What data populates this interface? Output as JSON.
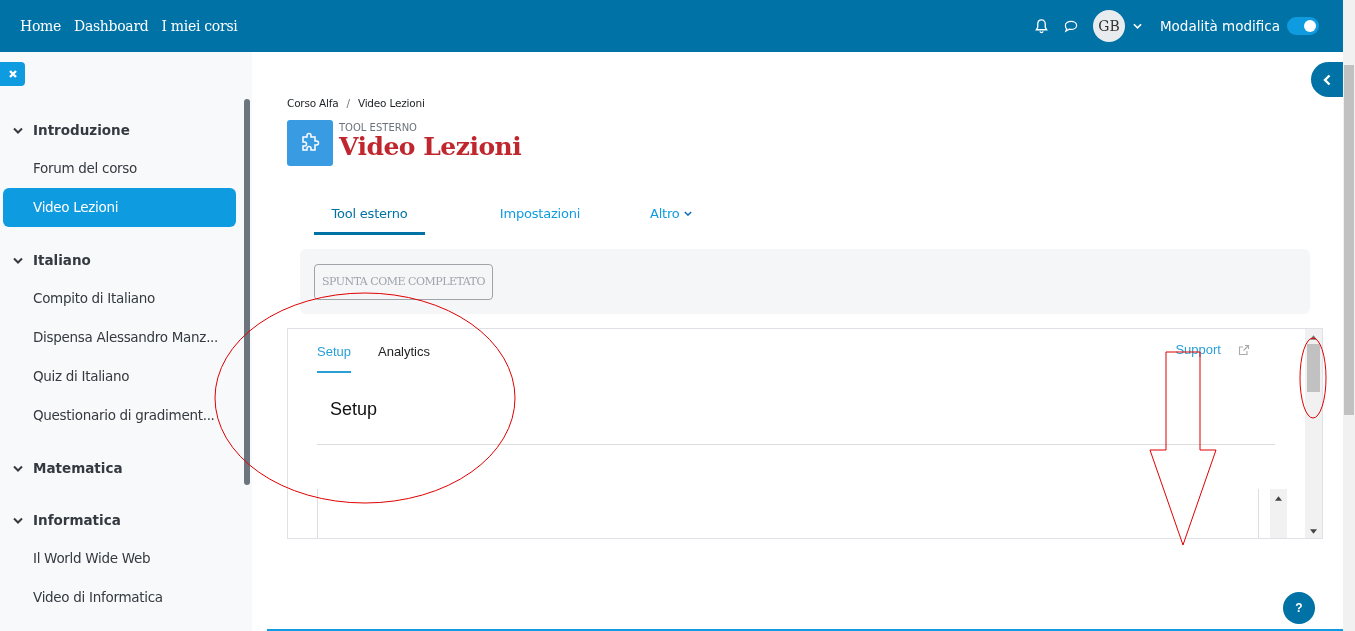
{
  "navbar": {
    "links": [
      "Home",
      "Dashboard",
      "I miei corsi"
    ],
    "avatar": "GB",
    "edit_mode": {
      "label": "Modalità modifica",
      "on": true
    }
  },
  "sidebar": {
    "sections": [
      {
        "title": "Introduzione",
        "expanded": true,
        "children": [
          {
            "label": "Forum del corso",
            "selected": false
          },
          {
            "label": "Video Lezioni",
            "selected": true
          }
        ]
      },
      {
        "title": "Italiano",
        "expanded": true,
        "children": [
          {
            "label": "Compito di Italiano",
            "selected": false
          },
          {
            "label": "Dispensa Alessandro Manz...",
            "selected": false
          },
          {
            "label": "Quiz di Italiano",
            "selected": false
          },
          {
            "label": "Questionario di gradiment...",
            "selected": false
          }
        ]
      },
      {
        "title": "Matematica",
        "expanded": true
      },
      {
        "title": "Informatica",
        "expanded": true,
        "children": [
          {
            "label": "Il World Wide Web",
            "selected": false
          },
          {
            "label": "Video di Informatica",
            "selected": false
          }
        ]
      }
    ]
  },
  "breadcrumb": {
    "items": [
      "Corso Alfa",
      "Video Lezioni"
    ],
    "separator": "/"
  },
  "activity": {
    "type_label": "TOOL ESTERNO",
    "title": "Video Lezioni"
  },
  "tabs": [
    {
      "label": "Tool esterno",
      "selected": true,
      "dropdown": false
    },
    {
      "label": "Impostazioni",
      "selected": false,
      "dropdown": false
    },
    {
      "label": "Altro",
      "selected": false,
      "dropdown": true
    }
  ],
  "completion_button": "SPUNTA COME COMPLETATO",
  "embedded": {
    "tabs": [
      {
        "label": "Setup",
        "selected": true
      },
      {
        "label": "Analytics",
        "selected": false
      }
    ],
    "support_link": "Support",
    "heading": "Setup"
  },
  "help_button": "?"
}
